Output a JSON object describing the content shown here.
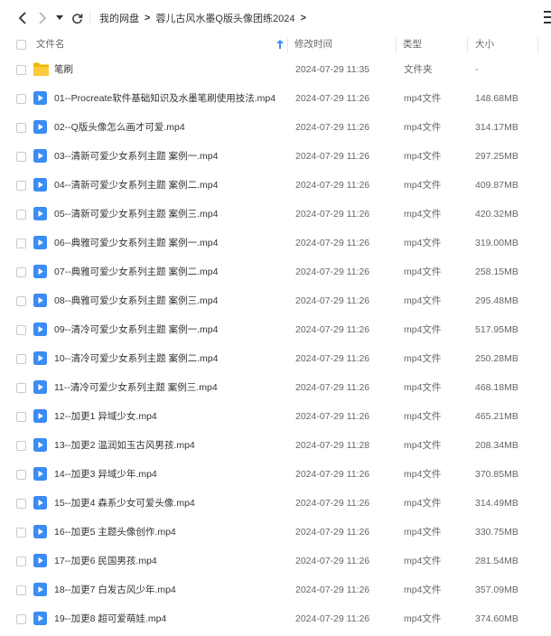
{
  "breadcrumb": [
    "我的网盘",
    "蓉儿古风水墨Q版头像团练2024"
  ],
  "columns": {
    "name": "文件名",
    "date": "修改时间",
    "type": "类型",
    "size": "大小"
  },
  "rows": [
    {
      "name": "笔刷",
      "date": "2024-07-29 11:35",
      "type": "文件夹",
      "size": "-",
      "icon": "folder-icon"
    },
    {
      "name": "01--Procreate软件基础知识及水墨笔刷使用技法.mp4",
      "date": "2024-07-29 11:26",
      "type": "mp4文件",
      "size": "148.68MB",
      "icon": "video-file-icon"
    },
    {
      "name": "02--Q版头像怎么画才可爱.mp4",
      "date": "2024-07-29 11:26",
      "type": "mp4文件",
      "size": "314.17MB",
      "icon": "video-file-icon"
    },
    {
      "name": "03--清新可爱少女系列主题 案例一.mp4",
      "date": "2024-07-29 11:26",
      "type": "mp4文件",
      "size": "297.25MB",
      "icon": "video-file-icon"
    },
    {
      "name": "04--清新可爱少女系列主题 案例二.mp4",
      "date": "2024-07-29 11:26",
      "type": "mp4文件",
      "size": "409.87MB",
      "icon": "video-file-icon"
    },
    {
      "name": "05--清新可爱少女系列主题 案例三.mp4",
      "date": "2024-07-29 11:26",
      "type": "mp4文件",
      "size": "420.32MB",
      "icon": "video-file-icon"
    },
    {
      "name": "06--典雅可爱少女系列主题 案例一.mp4",
      "date": "2024-07-29 11:26",
      "type": "mp4文件",
      "size": "319.00MB",
      "icon": "video-file-icon"
    },
    {
      "name": "07--典雅可爱少女系列主题 案例二.mp4",
      "date": "2024-07-29 11:26",
      "type": "mp4文件",
      "size": "258.15MB",
      "icon": "video-file-icon"
    },
    {
      "name": "08--典雅可爱少女系列主题 案例三.mp4",
      "date": "2024-07-29 11:26",
      "type": "mp4文件",
      "size": "295.48MB",
      "icon": "video-file-icon"
    },
    {
      "name": "09--清冷可爱少女系列主题 案例一.mp4",
      "date": "2024-07-29 11:26",
      "type": "mp4文件",
      "size": "517.95MB",
      "icon": "video-file-icon"
    },
    {
      "name": "10--清冷可爱少女系列主题 案例二.mp4",
      "date": "2024-07-29 11:26",
      "type": "mp4文件",
      "size": "250.28MB",
      "icon": "video-file-icon"
    },
    {
      "name": "11--清冷可爱少女系列主题 案例三.mp4",
      "date": "2024-07-29 11:26",
      "type": "mp4文件",
      "size": "468.18MB",
      "icon": "video-file-icon"
    },
    {
      "name": "12--加更1 异域少女.mp4",
      "date": "2024-07-29 11:26",
      "type": "mp4文件",
      "size": "465.21MB",
      "icon": "video-file-icon"
    },
    {
      "name": "13--加更2 温润如玉古风男孩.mp4",
      "date": "2024-07-29 11:28",
      "type": "mp4文件",
      "size": "208.34MB",
      "icon": "video-file-icon"
    },
    {
      "name": "14--加更3 异域少年.mp4",
      "date": "2024-07-29 11:26",
      "type": "mp4文件",
      "size": "370.85MB",
      "icon": "video-file-icon"
    },
    {
      "name": "15--加更4 森系少女可爱头像.mp4",
      "date": "2024-07-29 11:26",
      "type": "mp4文件",
      "size": "314.49MB",
      "icon": "video-file-icon"
    },
    {
      "name": "16--加更5 主题头像创作.mp4",
      "date": "2024-07-29 11:26",
      "type": "mp4文件",
      "size": "330.75MB",
      "icon": "video-file-icon"
    },
    {
      "name": "17--加更6 民国男孩.mp4",
      "date": "2024-07-29 11:26",
      "type": "mp4文件",
      "size": "281.54MB",
      "icon": "video-file-icon"
    },
    {
      "name": "18--加更7 白发古风少年.mp4",
      "date": "2024-07-29 11:26",
      "type": "mp4文件",
      "size": "357.09MB",
      "icon": "video-file-icon"
    },
    {
      "name": "19--加更8 超可爱萌娃.mp4",
      "date": "2024-07-29 11:26",
      "type": "mp4文件",
      "size": "374.60MB",
      "icon": "video-file-icon"
    }
  ],
  "colors": {
    "accent": "#3b8cf5",
    "folder": "#f5b400",
    "text": "#333333",
    "muted": "#666666"
  }
}
